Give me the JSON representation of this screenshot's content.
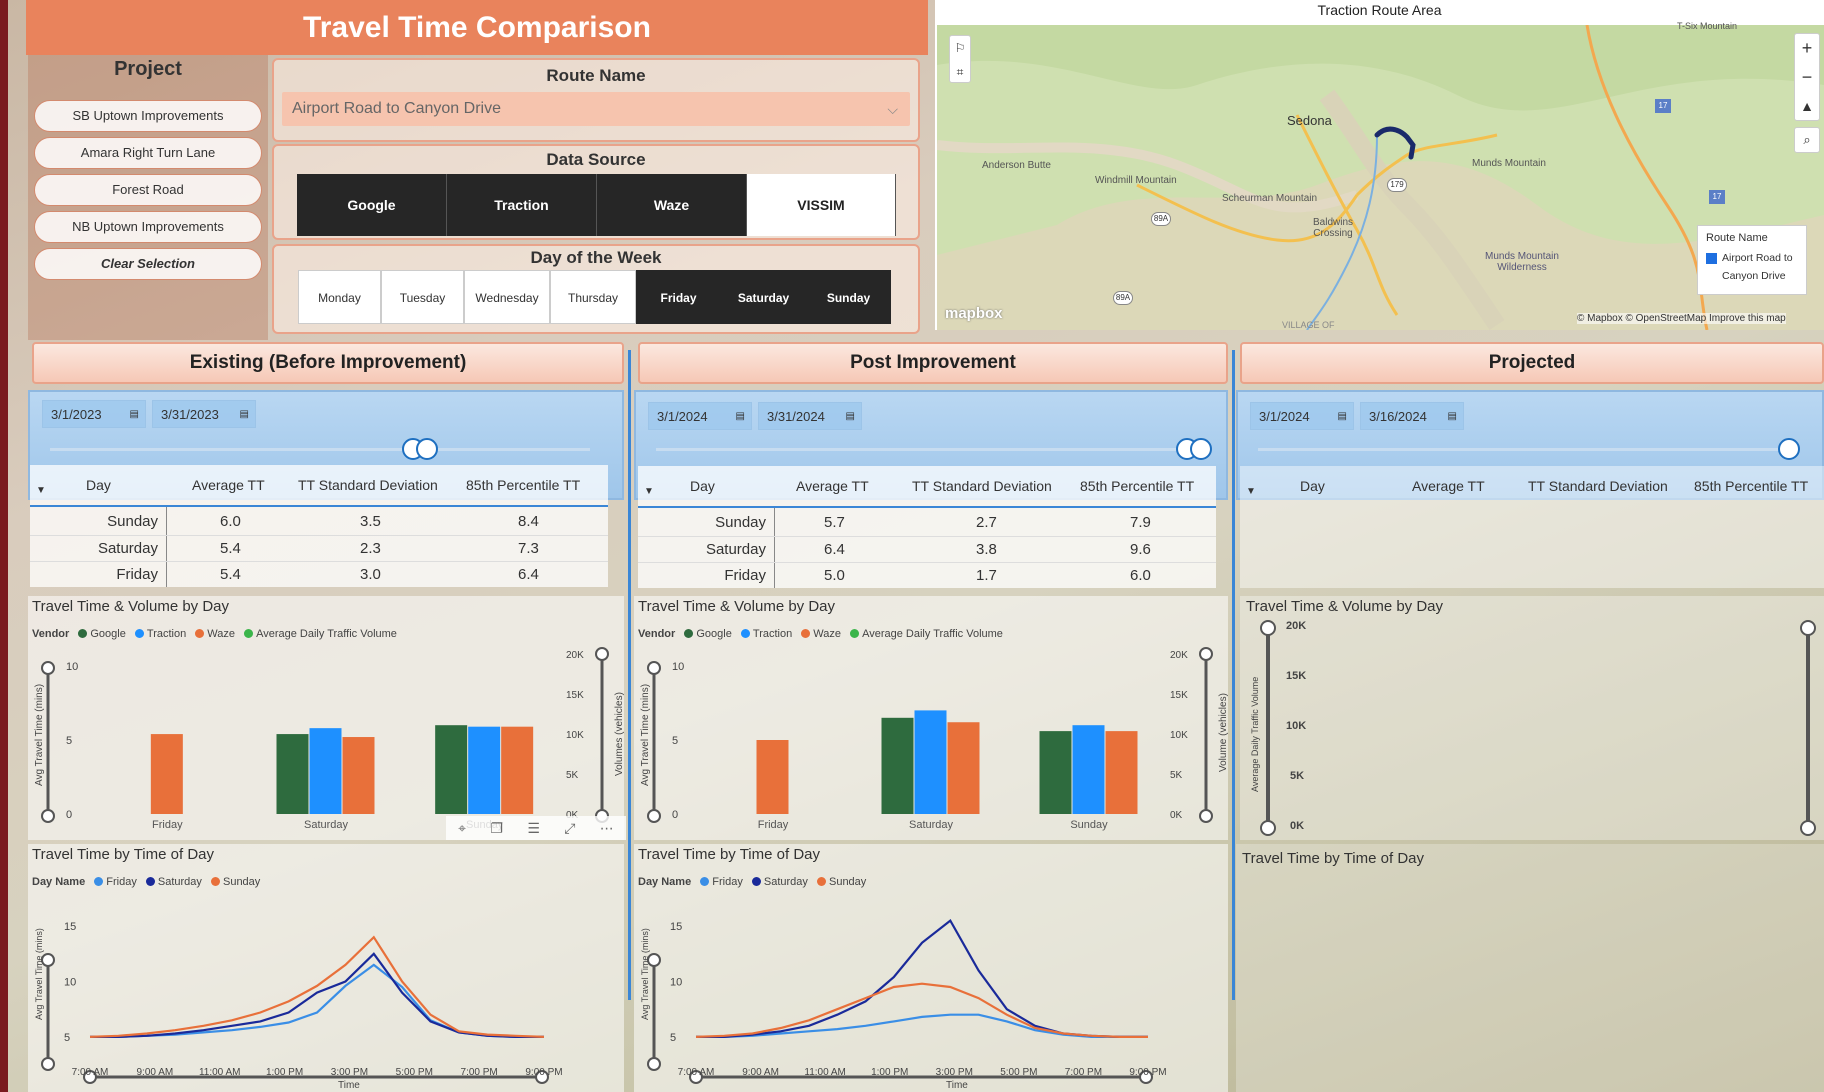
{
  "title": "Travel Time Comparison",
  "project": {
    "title": "Project",
    "items": [
      "SB Uptown Improvements",
      "Amara Right Turn Lane",
      "Forest Road",
      "NB Uptown Improvements"
    ],
    "clear": "Clear Selection"
  },
  "route": {
    "title": "Route Name",
    "value": "Airport Road to Canyon Drive"
  },
  "source": {
    "title": "Data Source",
    "items": [
      "Google",
      "Traction",
      "Waze",
      "VISSIM"
    ],
    "selected": "VISSIM"
  },
  "days": {
    "title": "Day of the Week",
    "items": [
      "Monday",
      "Tuesday",
      "Wednesday",
      "Thursday",
      "Friday",
      "Saturday",
      "Sunday"
    ],
    "selected": [
      "Friday",
      "Saturday",
      "Sunday"
    ]
  },
  "map": {
    "title": "Traction Route Area",
    "labels": {
      "sedona": "Sedona",
      "anderson": "Anderson Butte",
      "windmill": "Windmill Mountain",
      "scheurman": "Scheurman Mountain",
      "baldwins": "Baldwins\nCrossing",
      "munds": "Munds Mountain",
      "wilderness": "Munds Mountain\nWilderness",
      "tsix": "T-Six Mountain",
      "village": "VILLAGE OF"
    },
    "legend_title": "Route Name",
    "legend_item": "Airport Road to Canyon Drive",
    "attribution": "© Mapbox © OpenStreetMap  Improve this map",
    "brand": "mapbox",
    "shields": [
      "179",
      "89A",
      "89A",
      "17",
      "17"
    ]
  },
  "sections": [
    {
      "head": "Existing (Before Improvement)",
      "start": "3/1/2023",
      "end": "3/31/2023",
      "cols": [
        "Day",
        "Average TT",
        "TT Standard Deviation",
        "85th Percentile TT"
      ],
      "rows": [
        [
          "Sunday",
          "6.0",
          "3.5",
          "8.4"
        ],
        [
          "Saturday",
          "5.4",
          "2.3",
          "7.3"
        ],
        [
          "Friday",
          "5.4",
          "3.0",
          "6.4"
        ]
      ]
    },
    {
      "head": "Post Improvement",
      "start": "3/1/2024",
      "end": "3/31/2024",
      "cols": [
        "Day",
        "Average TT",
        "TT Standard Deviation",
        "85th Percentile TT"
      ],
      "rows": [
        [
          "Sunday",
          "5.7",
          "2.7",
          "7.9"
        ],
        [
          "Saturday",
          "6.4",
          "3.8",
          "9.6"
        ],
        [
          "Friday",
          "5.0",
          "1.7",
          "6.0"
        ]
      ]
    },
    {
      "head": "Projected",
      "start": "3/1/2024",
      "end": "3/16/2024",
      "cols": [
        "Day",
        "Average TT",
        "TT Standard Deviation",
        "85th Percentile TT"
      ],
      "rows": []
    }
  ],
  "vol_chart": {
    "title": "Travel Time & Volume by Day",
    "legend_label": "Vendor",
    "legend": [
      "Google",
      "Traction",
      "Waze",
      "Average Daily Traffic Volume"
    ],
    "ylabel": "Avg Travel Time (mins)",
    "y2label": "Volumes (vehicles)",
    "y2label_post": "Volume (vehicles)",
    "y2label_proj": "Average Daily Traffic Volume",
    "yticks": [
      "0",
      "5",
      "10"
    ],
    "y2ticks": [
      "0K",
      "5K",
      "10K",
      "15K",
      "20K"
    ]
  },
  "tod_chart": {
    "title": "Travel Time by Time of Day",
    "legend_label": "Day Name",
    "legend": [
      "Friday",
      "Saturday",
      "Sunday"
    ],
    "ylabel": "Avg Travel Time (mins)",
    "xlabel": "Time",
    "yticks_a": [
      "5",
      "10",
      "15"
    ],
    "xticks": [
      "7:00 AM",
      "9:00 AM",
      "11:00 AM",
      "1:00 PM",
      "3:00 PM",
      "5:00 PM",
      "7:00 PM",
      "9:00 PM"
    ]
  },
  "colors": {
    "google": "#2e6b3e",
    "traction": "#1e90ff",
    "waze": "#e8703a",
    "friday": "#3a8ee6",
    "saturday": "#1a2a9a",
    "sunday": "#e8703a"
  },
  "chart_data": [
    {
      "type": "bar",
      "title": "Travel Time & Volume by Day",
      "categories": [
        "Friday",
        "Saturday",
        "Sunday"
      ],
      "ylim": [
        0,
        10
      ],
      "series": [
        {
          "name": "Google",
          "values": [
            null,
            5.4,
            6.0
          ]
        },
        {
          "name": "Traction",
          "values": [
            null,
            5.8,
            5.9
          ]
        },
        {
          "name": "Waze",
          "values": [
            5.4,
            5.2,
            5.9
          ]
        }
      ]
    },
    {
      "type": "bar",
      "title": "Travel Time & Volume by Day",
      "categories": [
        "Friday",
        "Saturday",
        "Sunday"
      ],
      "ylim": [
        0,
        10
      ],
      "series": [
        {
          "name": "Google",
          "values": [
            null,
            6.5,
            5.6
          ]
        },
        {
          "name": "Traction",
          "values": [
            null,
            7.0,
            6.0
          ]
        },
        {
          "name": "Waze",
          "values": [
            5.0,
            6.2,
            5.6
          ]
        }
      ]
    },
    {
      "type": "line",
      "title": "Travel Time by Time of Day",
      "xlabel": "Time",
      "ylim": [
        3,
        17
      ],
      "series": [
        {
          "name": "Friday",
          "values": [
            5,
            5,
            5.1,
            5.2,
            5.4,
            5.6,
            5.9,
            6.3,
            7.2,
            9.6,
            11.5,
            9.5,
            6.5,
            5.4,
            5.1,
            5,
            5
          ]
        },
        {
          "name": "Saturday",
          "values": [
            5,
            5,
            5.1,
            5.3,
            5.6,
            6,
            6.4,
            7.2,
            9,
            10,
            12.5,
            9,
            6.4,
            5.4,
            5.1,
            5,
            5
          ]
        },
        {
          "name": "Sunday",
          "values": [
            5,
            5.1,
            5.3,
            5.6,
            6,
            6.5,
            7.2,
            8.2,
            9.6,
            11.5,
            14,
            10,
            7,
            5.5,
            5.2,
            5.1,
            5
          ]
        }
      ]
    },
    {
      "type": "line",
      "title": "Travel Time by Time of Day",
      "xlabel": "Time",
      "ylim": [
        3,
        17
      ],
      "series": [
        {
          "name": "Friday",
          "values": [
            5,
            5,
            5.1,
            5.3,
            5.5,
            5.7,
            6,
            6.4,
            6.8,
            7,
            7,
            6.4,
            5.6,
            5.2,
            5,
            5,
            5
          ]
        },
        {
          "name": "Saturday",
          "values": [
            5,
            5,
            5.2,
            5.5,
            6,
            7,
            8.2,
            10.4,
            13.5,
            15.5,
            11,
            7.5,
            6,
            5.3,
            5.1,
            5,
            5
          ]
        },
        {
          "name": "Sunday",
          "values": [
            5,
            5.1,
            5.3,
            5.8,
            6.5,
            7.5,
            8.5,
            9.5,
            9.8,
            9.5,
            8.5,
            7,
            5.8,
            5.3,
            5.1,
            5,
            5
          ]
        }
      ]
    }
  ]
}
